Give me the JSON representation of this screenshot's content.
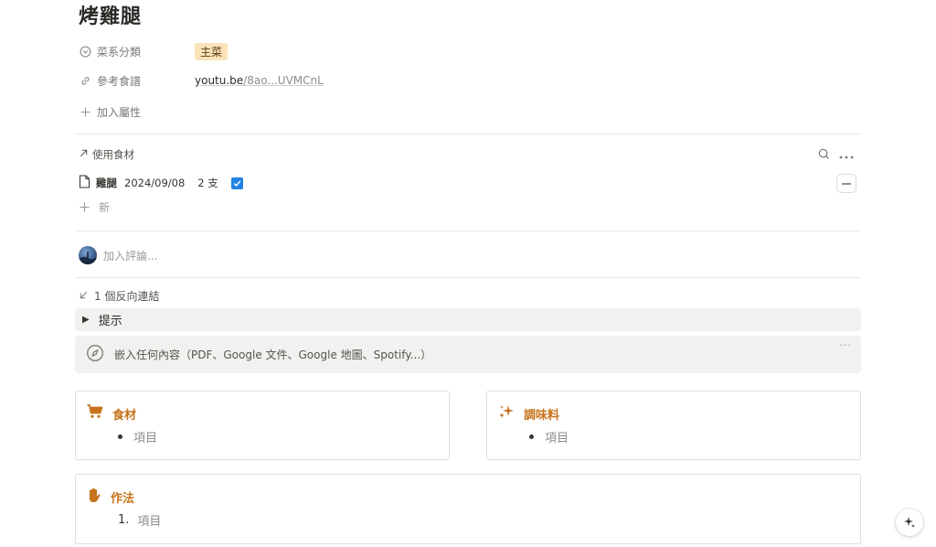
{
  "page": {
    "title": "烤雞腿"
  },
  "properties": {
    "category": {
      "label": "菜系分類",
      "value": "主菜",
      "icon": "chevron-circle-icon"
    },
    "reference": {
      "label": "參考食譜",
      "value_domain": "youtu.be",
      "value_rest": "/8ao...UVMCnL",
      "icon": "link-icon"
    },
    "add_property": "加入屬性"
  },
  "relation": {
    "header": "使用食材",
    "items": [
      {
        "name": "雞腿",
        "date": "2024/09/08",
        "qty": "2 支",
        "checked": true
      }
    ],
    "new_label": "新"
  },
  "comment": {
    "placeholder": "加入評論..."
  },
  "backlinks": {
    "label": "1 個反向連結"
  },
  "toggle": {
    "label": "提示"
  },
  "embed": {
    "placeholder": "嵌入任何內容（PDF、Google 文件、Google 地圖、Spotify...）",
    "more": "···"
  },
  "cards": {
    "ingredients": {
      "title": "食材",
      "item": "項目",
      "icon": "shopping-cart-icon"
    },
    "seasoning": {
      "title": "調味料",
      "item": "項目",
      "icon": "sparkles-icon"
    },
    "method": {
      "title": "作法",
      "item_number": "1.",
      "item": "項目",
      "icon": "hand-icon"
    }
  },
  "colors": {
    "accent_orange": "#c6731c",
    "tag_bg": "#fae3b8",
    "checkbox_blue": "#2383e2",
    "block_gray": "#f1f1ef"
  }
}
